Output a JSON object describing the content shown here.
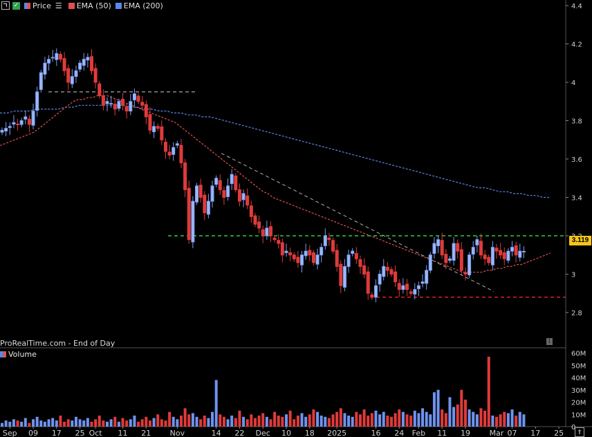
{
  "legend": {
    "price_label": "Price",
    "ema50_label": "EMA (50)",
    "ema200_label": "EMA (200)",
    "colors": {
      "price": "#e05050",
      "ema50": "#e05050",
      "ema200": "#5a88e8"
    }
  },
  "watermark": "ProRealTime.com - End of Day",
  "volume_label": "Volume",
  "last_price_tag": "3.119",
  "icons": {
    "expand": "expand-icon",
    "check": "check-icon",
    "lines": "lines-icon",
    "info": "info-icon",
    "scroll": "scroll-arrow-icon"
  },
  "chart_data": [
    {
      "type": "candlestick",
      "title": "",
      "ylim": [
        2.58,
        4.44
      ],
      "y_ticks": [
        "2.8",
        "3",
        "3.2",
        "3.4",
        "3.6",
        "3.8",
        "4",
        "4.2",
        "4.4"
      ],
      "x_tick_labels": [
        {
          "label": "Sep",
          "bar": 2
        },
        {
          "label": "09",
          "bar": 8
        },
        {
          "label": "17",
          "bar": 14
        },
        {
          "label": "25",
          "bar": 20
        },
        {
          "label": "Oct",
          "bar": 24
        },
        {
          "label": "11",
          "bar": 31
        },
        {
          "label": "21",
          "bar": 37
        },
        {
          "label": "Nov",
          "bar": 45
        },
        {
          "label": "14",
          "bar": 55
        },
        {
          "label": "22",
          "bar": 61
        },
        {
          "label": "Dec",
          "bar": 67
        },
        {
          "label": "10",
          "bar": 73
        },
        {
          "label": "18",
          "bar": 79
        },
        {
          "label": "2025",
          "bar": 86
        },
        {
          "label": "16",
          "bar": 96
        },
        {
          "label": "24",
          "bar": 102
        },
        {
          "label": "Feb",
          "bar": 107
        },
        {
          "label": "11",
          "bar": 113
        },
        {
          "label": "19",
          "bar": 119
        },
        {
          "label": "Mar",
          "bar": 127
        },
        {
          "label": "07",
          "bar": 131
        },
        {
          "label": "17",
          "bar": 137
        },
        {
          "label": "25",
          "bar": 143
        }
      ],
      "close": [
        3.75,
        3.76,
        3.77,
        3.79,
        3.78,
        3.8,
        3.82,
        3.78,
        3.85,
        3.95,
        4.05,
        4.1,
        4.12,
        4.13,
        4.15,
        4.12,
        4.06,
        4.0,
        4.03,
        4.06,
        4.1,
        4.12,
        4.13,
        4.06,
        4.0,
        3.93,
        3.88,
        3.9,
        3.89,
        3.86,
        3.9,
        3.88,
        3.85,
        3.9,
        3.94,
        3.9,
        3.88,
        3.82,
        3.75,
        3.77,
        3.76,
        3.7,
        3.64,
        3.62,
        3.66,
        3.68,
        3.58,
        3.44,
        3.18,
        3.38,
        3.46,
        3.4,
        3.32,
        3.38,
        3.46,
        3.5,
        3.44,
        3.4,
        3.46,
        3.52,
        3.44,
        3.38,
        3.42,
        3.36,
        3.3,
        3.26,
        3.24,
        3.2,
        3.24,
        3.2,
        3.18,
        3.16,
        3.1,
        3.12,
        3.1,
        3.08,
        3.06,
        3.1,
        3.12,
        3.1,
        3.06,
        3.1,
        3.14,
        3.2,
        3.18,
        3.12,
        3.04,
        2.94,
        3.04,
        3.1,
        3.12,
        3.08,
        3.04,
        3.0,
        2.9,
        2.88,
        2.94,
        3.0,
        3.04,
        3.02,
        3.0,
        2.96,
        2.92,
        2.94,
        2.92,
        2.9,
        2.92,
        2.94,
        2.96,
        3.02,
        3.1,
        3.16,
        3.18,
        3.1,
        3.06,
        3.08,
        3.16,
        3.12,
        3.02,
        3.0,
        3.1,
        3.14,
        3.18,
        3.1,
        3.08,
        3.06,
        3.14,
        3.12,
        3.1,
        3.08,
        3.12,
        3.14,
        3.1,
        3.12,
        3.119
      ],
      "volume_millions": [
        3,
        5,
        4,
        6,
        5,
        4,
        7,
        3,
        6,
        8,
        5,
        4,
        6,
        7,
        5,
        9,
        4,
        6,
        5,
        8,
        6,
        5,
        7,
        4,
        6,
        9,
        5,
        4,
        6,
        8,
        4,
        7,
        5,
        6,
        9,
        4,
        6,
        8,
        5,
        7,
        10,
        6,
        5,
        12,
        8,
        6,
        9,
        15,
        10,
        11,
        8,
        6,
        9,
        7,
        12,
        38,
        10,
        8,
        6,
        9,
        7,
        13,
        8,
        6,
        10,
        7,
        9,
        11,
        8,
        6,
        12,
        9,
        8,
        10,
        13,
        6,
        9,
        11,
        8,
        10,
        14,
        12,
        9,
        8,
        7,
        10,
        12,
        15,
        11,
        9,
        8,
        12,
        10,
        14,
        9,
        11,
        13,
        10,
        12,
        9,
        8,
        11,
        14,
        12,
        10,
        9,
        13,
        11,
        15,
        12,
        10,
        28,
        30,
        14,
        11,
        24,
        16,
        18,
        30,
        22,
        14,
        12,
        10,
        15,
        13,
        57,
        9,
        8,
        10,
        12,
        11,
        14,
        9,
        12,
        10
      ]
    },
    {
      "type": "line",
      "name": "EMA (50)",
      "values": [
        3.67,
        3.68,
        3.69,
        3.7,
        3.71,
        3.72,
        3.73,
        3.74,
        3.76,
        3.78,
        3.8,
        3.82,
        3.84,
        3.86,
        3.88,
        3.9,
        3.91,
        3.91,
        3.92,
        3.92,
        3.93,
        3.93,
        3.93,
        3.92,
        3.91,
        3.9,
        3.89,
        3.88,
        3.87,
        3.86,
        3.85,
        3.84,
        3.83,
        3.82,
        3.81,
        3.8,
        3.79,
        3.77,
        3.75,
        3.73,
        3.71,
        3.69,
        3.67,
        3.65,
        3.63,
        3.61,
        3.59,
        3.57,
        3.55,
        3.53,
        3.51,
        3.49,
        3.47,
        3.45,
        3.43,
        3.42,
        3.4,
        3.39,
        3.38,
        3.37,
        3.36,
        3.35,
        3.34,
        3.33,
        3.32,
        3.31,
        3.3,
        3.29,
        3.28,
        3.27,
        3.26,
        3.25,
        3.24,
        3.23,
        3.22,
        3.21,
        3.2,
        3.19,
        3.18,
        3.17,
        3.16,
        3.15,
        3.14,
        3.13,
        3.12,
        3.11,
        3.1,
        3.09,
        3.08,
        3.07,
        3.06,
        3.05,
        3.04,
        3.03,
        3.02,
        3.01,
        3.01,
        3.01,
        3.01,
        3.01,
        3.02,
        3.02,
        3.03,
        3.03,
        3.04,
        3.04,
        3.05,
        3.05,
        3.06,
        3.07,
        3.08,
        3.09,
        3.1,
        3.11
      ]
    },
    {
      "type": "line",
      "name": "EMA (200)",
      "values": [
        3.84,
        3.84,
        3.85,
        3.85,
        3.85,
        3.86,
        3.86,
        3.86,
        3.86,
        3.87,
        3.87,
        3.88,
        3.88,
        3.88,
        3.88,
        3.88,
        3.88,
        3.88,
        3.87,
        3.87,
        3.86,
        3.86,
        3.85,
        3.85,
        3.84,
        3.84,
        3.83,
        3.83,
        3.82,
        3.82,
        3.81,
        3.8,
        3.79,
        3.78,
        3.77,
        3.76,
        3.75,
        3.74,
        3.73,
        3.72,
        3.71,
        3.7,
        3.69,
        3.68,
        3.67,
        3.66,
        3.65,
        3.64,
        3.63,
        3.62,
        3.61,
        3.6,
        3.59,
        3.58,
        3.57,
        3.56,
        3.55,
        3.54,
        3.53,
        3.52,
        3.51,
        3.5,
        3.49,
        3.48,
        3.47,
        3.46,
        3.45,
        3.45,
        3.44,
        3.43,
        3.43,
        3.42,
        3.42,
        3.41,
        3.41,
        3.4,
        3.4
      ]
    },
    {
      "type": "annotations",
      "horizontal_levels": [
        {
          "value": 3.2,
          "color": "#2ecc40",
          "style": "dashed"
        },
        {
          "value": 2.88,
          "color": "#e02020",
          "style": "dashed"
        },
        {
          "value": 3.95,
          "color": "#d0d0d0",
          "style": "dashed"
        }
      ],
      "trendline": {
        "from": [
          3.63
        ],
        "to": [
          2.91
        ],
        "color": "#b0b0b0",
        "style": "dashed"
      }
    }
  ]
}
